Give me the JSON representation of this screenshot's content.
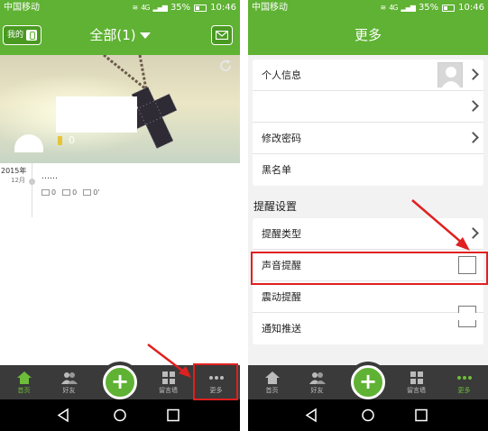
{
  "status_bar": {
    "carrier": "中国移动",
    "network": "4G",
    "battery": "35%",
    "time": "10:46"
  },
  "left_screen": {
    "header": {
      "mine_label": "我的",
      "title": "全部(1)"
    },
    "banner": {
      "count": "0"
    },
    "timeline": {
      "year": "2015年",
      "month": "12月",
      "post_text": "……",
      "stats": [
        "0",
        "0",
        "0'"
      ]
    },
    "tabs": [
      {
        "label": "首页",
        "icon": "home-icon",
        "active": true
      },
      {
        "label": "好友",
        "icon": "friends-icon",
        "active": false
      },
      {
        "label": "",
        "icon": "plus-icon",
        "active": false
      },
      {
        "label": "留言墙",
        "icon": "grid-icon",
        "active": false
      },
      {
        "label": "更多",
        "icon": "more-icon",
        "active": false
      }
    ]
  },
  "right_screen": {
    "header": {
      "title": "更多"
    },
    "account_rows": [
      {
        "label": "个人信息"
      },
      {
        "label": ""
      },
      {
        "label": "修改密码"
      },
      {
        "label": "黑名单"
      }
    ],
    "reminder_section": "提醒设置",
    "reminder_rows": [
      {
        "label": "提醒类型"
      },
      {
        "label": "声音提醒"
      },
      {
        "label": "震动提醒"
      },
      {
        "label": "通知推送"
      }
    ],
    "tabs": [
      {
        "label": "首页",
        "icon": "home-icon",
        "active": false
      },
      {
        "label": "好友",
        "icon": "friends-icon",
        "active": false
      },
      {
        "label": "",
        "icon": "plus-icon",
        "active": false
      },
      {
        "label": "留言墙",
        "icon": "grid-icon",
        "active": false
      },
      {
        "label": "更多",
        "icon": "more-icon",
        "active": true
      }
    ]
  },
  "colors": {
    "brand_green": "#5fb233",
    "tabbar": "#3a3a3a",
    "annotation_red": "#e02020"
  }
}
